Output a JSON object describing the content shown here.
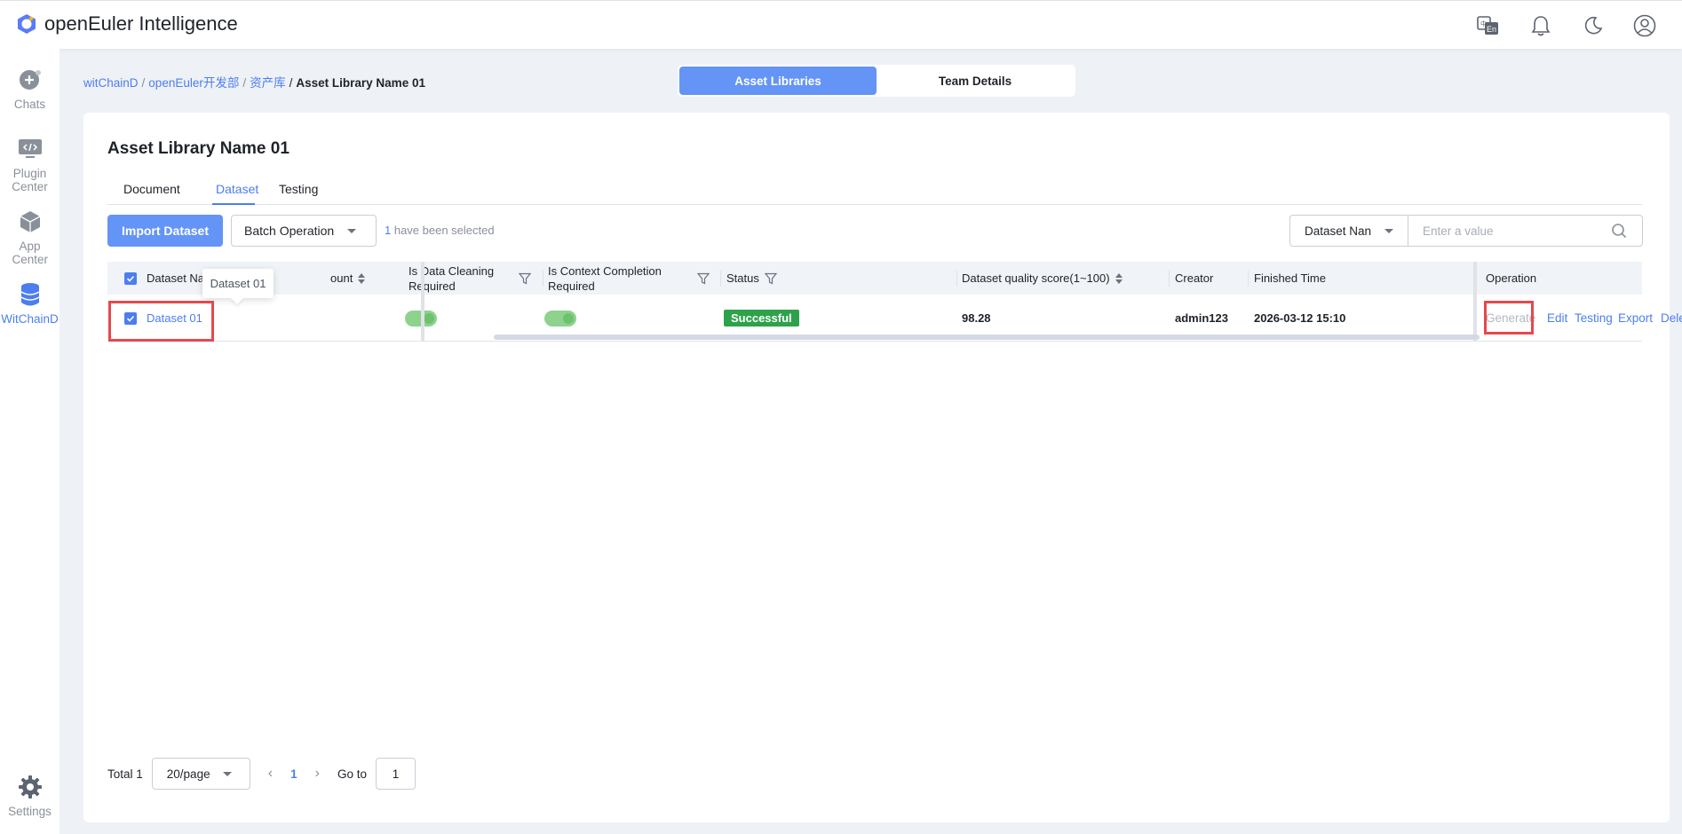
{
  "app": {
    "title": "openEuler Intelligence"
  },
  "header_icons": [
    "language-icon",
    "bell-icon",
    "moon-icon",
    "user-icon"
  ],
  "sidebar": {
    "items": [
      {
        "label": "Chats",
        "icon": "chat-plus-icon"
      },
      {
        "label": "Plugin Center",
        "icon": "code-monitor-icon"
      },
      {
        "label": "App Center",
        "icon": "cube-icon"
      },
      {
        "label": "WitChainD",
        "icon": "database-icon",
        "active": true
      },
      {
        "label": "Settings",
        "icon": "gear-icon"
      }
    ]
  },
  "breadcrumb": {
    "items": [
      "witChainD",
      "openEuler开发部",
      "资产库"
    ],
    "current": "Asset Library Name 01"
  },
  "top_tabs": [
    {
      "label": "Asset Libraries",
      "active": true
    },
    {
      "label": "Team Details",
      "active": false
    }
  ],
  "library": {
    "title": "Asset Library Name 01"
  },
  "tabs": [
    {
      "label": "Document",
      "active": false
    },
    {
      "label": "Dataset",
      "active": true
    },
    {
      "label": "Testing",
      "active": false
    }
  ],
  "toolbar": {
    "import_label": "Import Dataset",
    "batch_label": "Batch Operation",
    "selected_count": "1",
    "selected_suffix": " have been selected",
    "filter_field": "Dataset Nan",
    "search_placeholder": "Enter a value"
  },
  "table": {
    "headers": {
      "name": "Dataset Name",
      "count": "ount",
      "cleaning": "Is Data Cleaning Required",
      "context": "Is Context Completion Required",
      "status": "Status",
      "score": "Dataset quality score(1~100)",
      "creator": "Creator",
      "finished": "Finished Time",
      "operation": "Operation"
    },
    "rows": [
      {
        "name": "Dataset 01",
        "cleaning": true,
        "context": true,
        "status": "Successful",
        "score": "98.28",
        "creator": "admin123",
        "finished": "2026-03-12 15:10",
        "operations": [
          "Generate",
          "Edit",
          "Testing",
          "Export",
          "Delete"
        ]
      }
    ]
  },
  "tooltip": {
    "text": "Dataset 01"
  },
  "pagination": {
    "total": "Total 1",
    "page_size": "20/page",
    "current_page": "1",
    "goto_label": "Go to",
    "goto_value": "1"
  },
  "colors": {
    "primary": "#4c7ef0",
    "primary_button": "#6494f5",
    "success": "#2ea24a",
    "highlight": "#e5484d",
    "toggle_on": "#8dd28d"
  }
}
